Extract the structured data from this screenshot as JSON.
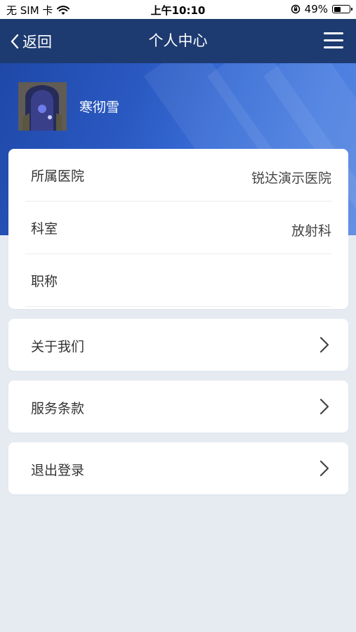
{
  "status_bar": {
    "carrier": "无 SIM 卡",
    "time": "上午10:10",
    "battery": "49%",
    "battery_level": 0.49
  },
  "nav": {
    "back_label": "返回",
    "title": "个人中心"
  },
  "profile": {
    "name": "寒彻雪"
  },
  "info": [
    {
      "label": "所属医院",
      "value": "锐达演示医院"
    },
    {
      "label": "科室",
      "value": "放射科"
    },
    {
      "label": "职称",
      "value": ""
    }
  ],
  "links": [
    {
      "label": "关于我们"
    },
    {
      "label": "服务条款"
    },
    {
      "label": "退出登录"
    }
  ],
  "colors": {
    "nav_bg": "#1d3b70",
    "banner_accent": "#2a59c2",
    "page_bg": "#e6ebf2"
  }
}
